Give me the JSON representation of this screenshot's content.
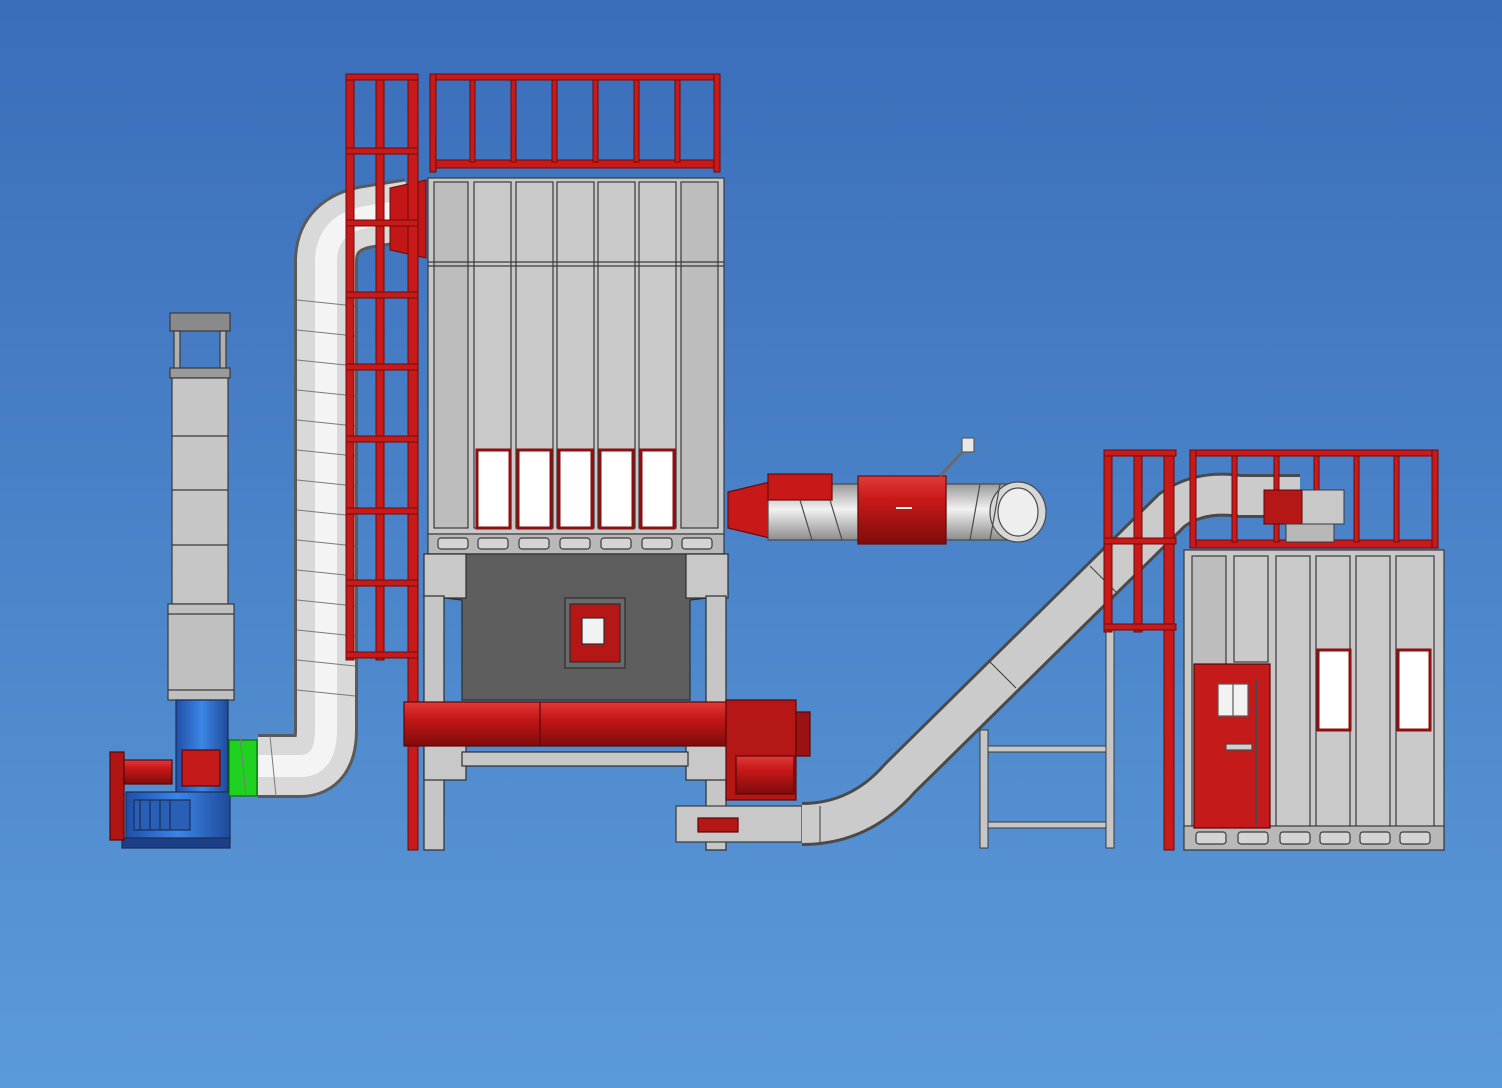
{
  "scene": {
    "colors": {
      "sky_top": "#3a6dba",
      "sky_bottom": "#5b9ad8",
      "steel_red": "#c91a1a",
      "steel_red_dark": "#8e0f0f",
      "panel_gray": "#c8c8c8",
      "panel_gray_dark": "#8a8a8a",
      "hopper_dark": "#5e5e5e",
      "duct_light": "#eeeeee",
      "duct_dark": "#9a9a9a",
      "motor_blue": "#2d6fd0",
      "coupling_green": "#1fd21f",
      "window_white": "#ffffff",
      "outline": "#3a3a3a"
    },
    "components": [
      "exhaust-stack",
      "blower-fan",
      "drive-motor",
      "spiral-duct",
      "access-ladder",
      "dust-collector",
      "top-railing",
      "filter-windows",
      "collector-hopper",
      "screw-conveyor",
      "inlet-duct",
      "inlet-damper",
      "inclined-conveyor",
      "support-frame",
      "booth-railing",
      "spray-booth",
      "booth-door"
    ]
  }
}
